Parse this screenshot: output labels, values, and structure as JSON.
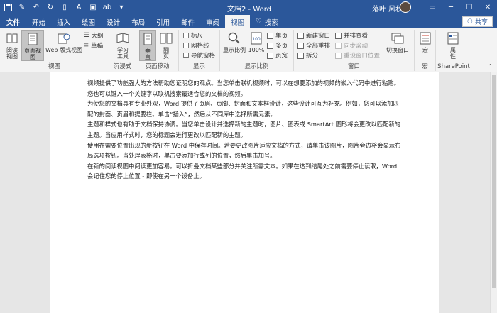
{
  "window": {
    "title": "文档2 - Word",
    "user": "落叶 风秋"
  },
  "tabs": {
    "file": "文件",
    "items": [
      "开始",
      "插入",
      "绘图",
      "设计",
      "布局",
      "引用",
      "邮件",
      "审阅",
      "视图"
    ],
    "active": "视图",
    "search": "搜索",
    "share": "共享"
  },
  "ribbon": {
    "views": {
      "label": "视图",
      "read": "阅读\n视图",
      "print": "页面视图",
      "web": "Web 版式视图",
      "outline": "大纲",
      "draft": "草稿"
    },
    "immersive": {
      "label": "沉浸式",
      "learning": "学习\n工具"
    },
    "page_move": {
      "label": "页面移动",
      "vertical": "垂\n直",
      "side": "翻\n页"
    },
    "show": {
      "label": "显示",
      "ruler": "标尺",
      "gridlines": "网格线",
      "nav": "导航窗格"
    },
    "zoom": {
      "label": "显示比例",
      "zoom": "显示比例",
      "hundred": "100%",
      "one_page": "单页",
      "multi": "多页",
      "page_width": "页宽"
    },
    "window": {
      "label": "窗口",
      "new": "新建窗口",
      "arrange": "全部重排",
      "split": "拆分",
      "side_by_side": "并排查看",
      "sync": "同步滚动",
      "reset": "重设窗口位置",
      "switch": "切换窗口"
    },
    "macros": {
      "label": "宏",
      "macro": "宏"
    },
    "sharepoint": {
      "label": "SharePoint",
      "props": "属\n性"
    }
  },
  "document": {
    "lines": [
      "视频提供了功能强大的方法帮助您证明您的观点。当您单击联机视频时，可以在想要添加的视频的嵌入代码中进行粘贴。",
      "您也可以键入一个关键字以联机搜索最适合您的文档的视频。",
      "为使您的文档具有专业外观，Word 提供了页眉、页脚、封面和文本框设计，这些设计可互为补充。例如，您可以添加匹",
      "配的封面、页眉和提要栏。单击“插入”，然后从不同库中选择所需元素。",
      "主题和样式也有助于文档保持协调。当您单击设计并选择新的主题时，图片、图表或 SmartArt 图形将会更改以匹配新的",
      "主题。当应用样式时，您的标题会进行更改以匹配新的主题。",
      "使用在需要位置出现的新按钮在 Word 中保存时间。若要更改图片适应文档的方式，请单击该图片，图片旁边将会显示布",
      "局选项按钮。当处理表格时，单击要添加行或列的位置，然后单击加号。",
      "在新的阅读视图中阅读更加容易。可以折叠文档某些部分并关注所需文本。如果在达到结尾处之前需要停止读取，Word",
      "会记住您的停止位置 - 即使在另一个设备上。"
    ]
  }
}
